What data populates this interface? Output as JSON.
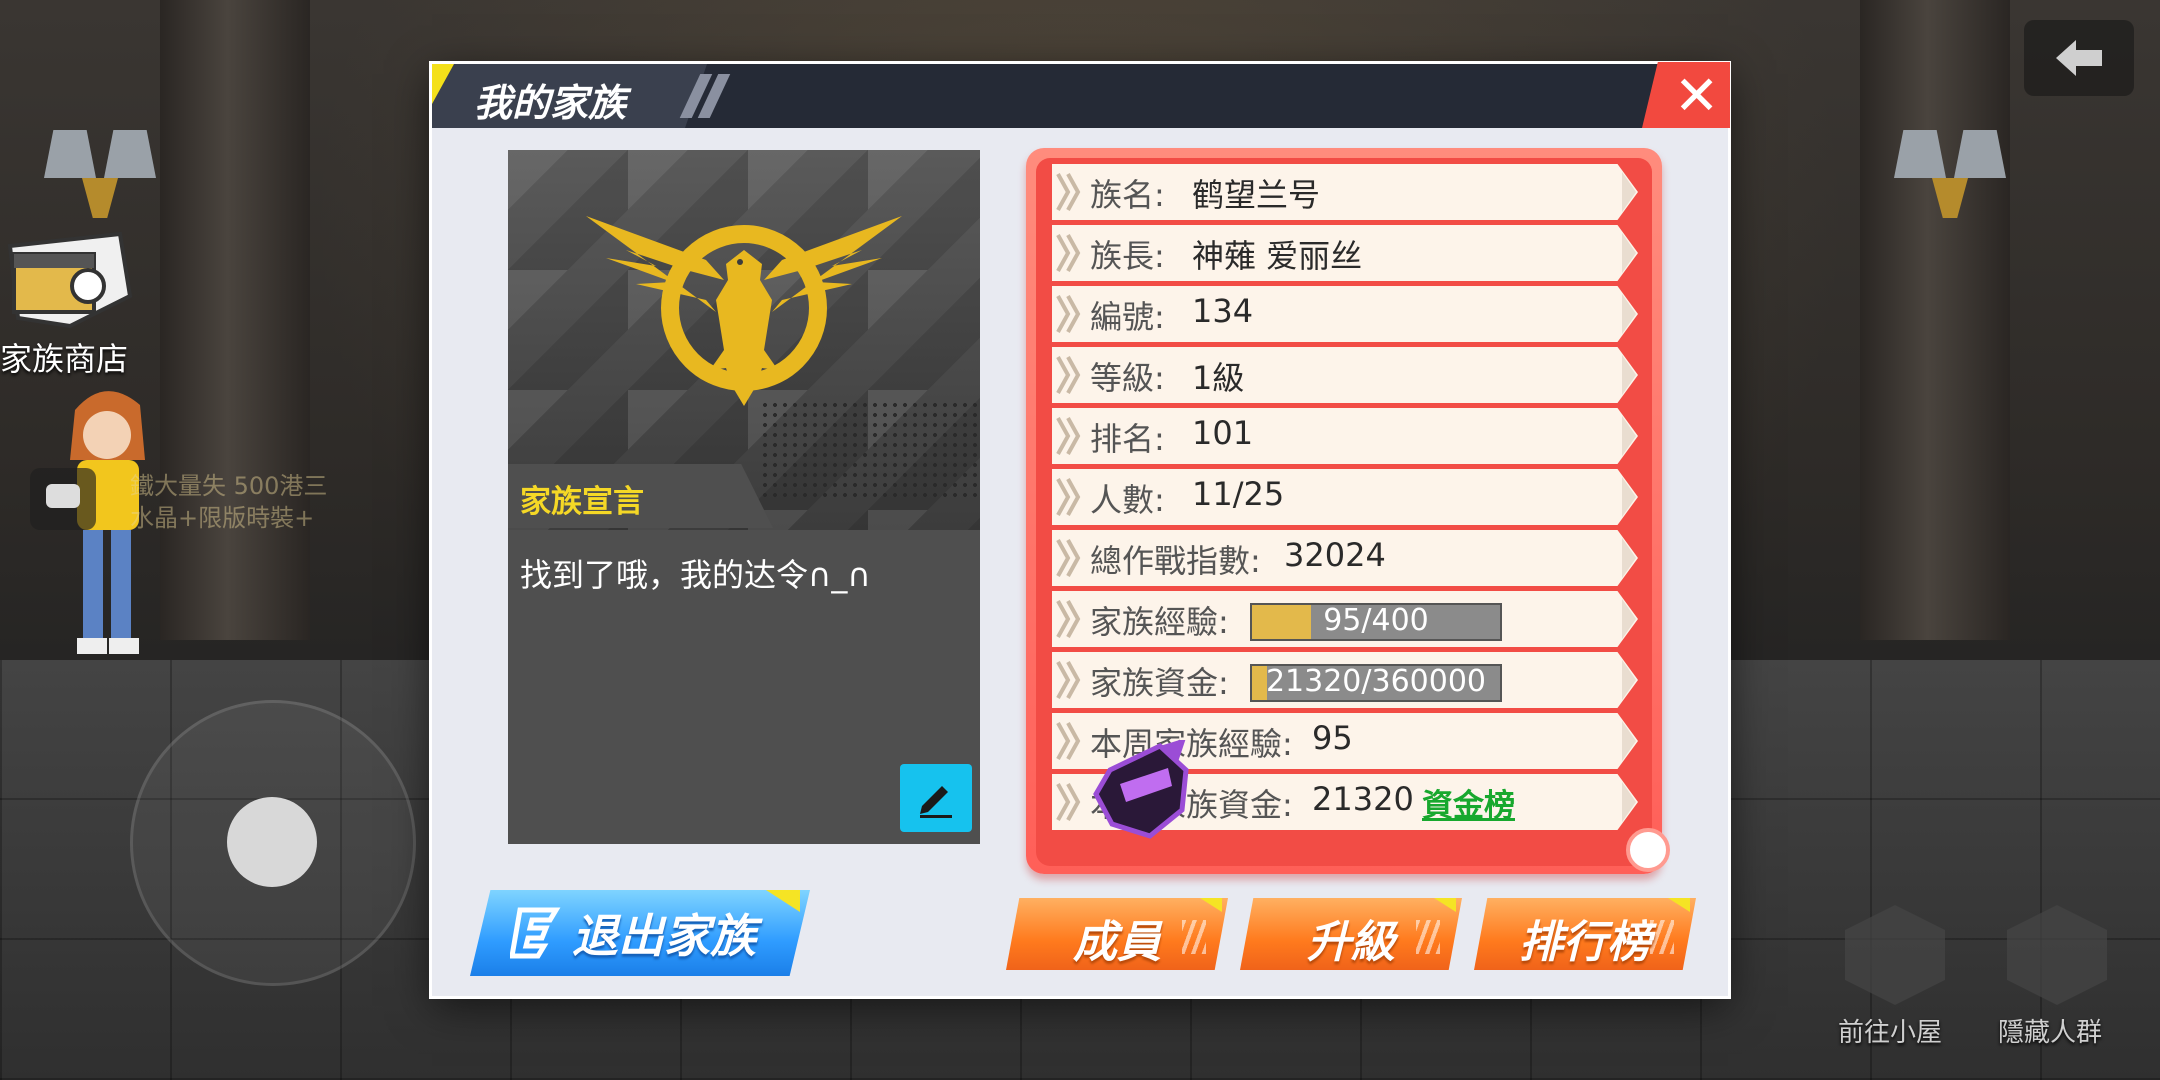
{
  "hud": {
    "shop_label": "家族商店",
    "ghost_line1": "鐵大量失 500港三",
    "ghost_line2": "水晶+限版時裝+",
    "go_cabin_label": "前往小屋",
    "hide_crowd_label": "隱藏人群"
  },
  "dialog": {
    "title": "我的家族",
    "close_glyph": "✕"
  },
  "declaration": {
    "title": "家族宣言",
    "text": "找到了哦，我的达令∩_∩"
  },
  "info": {
    "rows": [
      {
        "label": "族名:",
        "value": "鹤望兰号"
      },
      {
        "label": "族長:",
        "value": "神薙 爱丽丝"
      },
      {
        "label": "編號:",
        "value": "134"
      },
      {
        "label": "等級:",
        "value": "1級"
      },
      {
        "label": "排名:",
        "value": "101"
      },
      {
        "label": "人數:",
        "value": "11/25"
      },
      {
        "label": "總作戰指數:",
        "value": "32024"
      },
      {
        "label": "本周家族經驗:",
        "value": "95"
      },
      {
        "label": "本周家族資金:",
        "value": "21320"
      }
    ],
    "exp_label": "家族經驗:",
    "exp_text": "95/400",
    "exp_fraction": 0.2375,
    "funds_label": "家族資金:",
    "funds_text": "21320/360000",
    "funds_fraction": 0.0592,
    "funds_rank_link": "資金榜"
  },
  "buttons": {
    "leave": "退出家族",
    "members": "成員",
    "upgrade": "升級",
    "ranking": "排行榜"
  },
  "icons": {
    "back": "back-arrow-icon",
    "close": "close-icon",
    "emblem": "eagle-emblem-icon",
    "edit": "pencil-icon",
    "shop": "shop-chest-icon",
    "chat": "chat-icon"
  },
  "colors": {
    "accent_red": "#f24c45",
    "accent_blue": "#2f9cff",
    "accent_orange": "#ff7a1d",
    "emblem_gold": "#e8b820",
    "link_green": "#18a82e"
  }
}
